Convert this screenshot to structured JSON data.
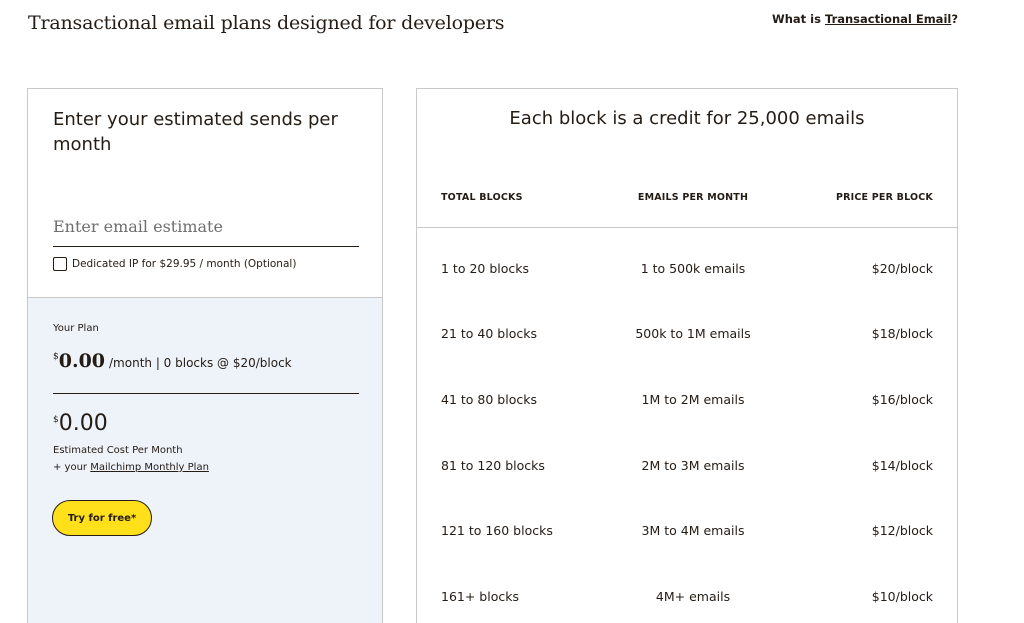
{
  "header": {
    "title": "Transactional email plans designed for developers",
    "what_is_prefix": "What is ",
    "what_is_link": "Transactional Email",
    "what_is_suffix": "?"
  },
  "estimator": {
    "heading": "Enter your estimated sends per month",
    "input_placeholder": "Enter email estimate",
    "input_value": "",
    "dedicated_ip_label": "Dedicated IP for $29.95 / month (Optional)",
    "dedicated_ip_checked": false
  },
  "plan": {
    "label": "Your Plan",
    "currency": "$",
    "amount": "0.00",
    "detail": "/month | 0 blocks @ $20/block",
    "cost_currency": "$",
    "cost_amount": "0.00",
    "cost_label": "Estimated Cost Per Month",
    "cost_note_prefix": "+ your ",
    "cost_note_link": "Mailchimp Monthly Plan",
    "cta_label": "Try for free*"
  },
  "pricing_table": {
    "heading": "Each block is a credit for 25,000 emails",
    "columns": [
      "TOTAL BLOCKS",
      "EMAILS PER MONTH",
      "PRICE PER BLOCK"
    ],
    "rows": [
      {
        "blocks": "1 to 20 blocks",
        "emails": "1 to 500k emails",
        "price": "$20/block"
      },
      {
        "blocks": "21 to 40 blocks",
        "emails": "500k to 1M emails",
        "price": "$18/block"
      },
      {
        "blocks": "41 to 80 blocks",
        "emails": "1M to 2M emails",
        "price": "$16/block"
      },
      {
        "blocks": "81 to 120 blocks",
        "emails": "2M to 3M emails",
        "price": "$14/block"
      },
      {
        "blocks": "121 to 160 blocks",
        "emails": "3M to 4M emails",
        "price": "$12/block"
      },
      {
        "blocks": "161+ blocks",
        "emails": "4M+ emails",
        "price": "$10/block"
      }
    ]
  }
}
